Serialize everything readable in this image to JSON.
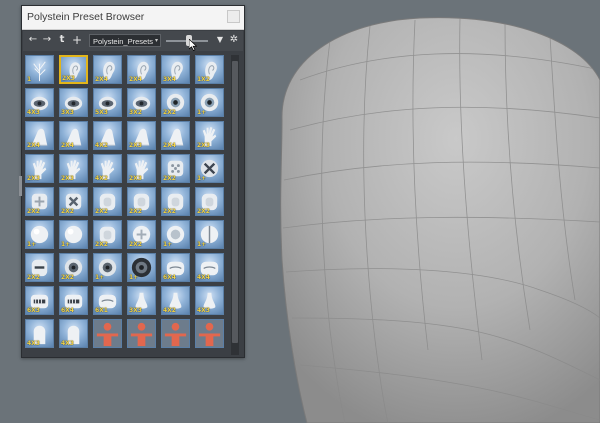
{
  "window": {
    "title": "Polystein Preset Browser"
  },
  "toolbar": {
    "back_glyph": "←",
    "forward_glyph": "→",
    "up_glyph": "t",
    "add_glyph": "+",
    "preset_value": "Polystein_Presets",
    "dropdown_glyph": "▾",
    "filter_glyph": "▼",
    "settings_glyph": "✲",
    "zoom_level": 0.55
  },
  "colors": {
    "tile_blue": "#90b3d8",
    "selected_border": "#e2b51a",
    "size_label": "#f1d448",
    "figure_red": "#e2674e",
    "mesh_gray": "#b4b4b4",
    "viewport_bg": "#6b7379"
  },
  "presets": [
    {
      "icon": "branch-icon",
      "size": "1"
    },
    {
      "icon": "ear-icon",
      "size": "2X3",
      "selected": true
    },
    {
      "icon": "ear-icon",
      "size": "2X4"
    },
    {
      "icon": "ear-icon",
      "size": "2X4"
    },
    {
      "icon": "ear-icon",
      "size": "3X4"
    },
    {
      "icon": "ear-icon",
      "size": "1X2"
    },
    {
      "icon": "eye-icon",
      "size": "4X3"
    },
    {
      "icon": "eye-icon",
      "size": "3X3"
    },
    {
      "icon": "eye-icon",
      "size": "5X3"
    },
    {
      "icon": "eye-icon",
      "size": "3X2"
    },
    {
      "icon": "eyeball-icon",
      "size": "2X2"
    },
    {
      "icon": "eyeball-icon",
      "size": "1+"
    },
    {
      "icon": "foot-icon",
      "size": "2X4"
    },
    {
      "icon": "foot-icon",
      "size": "2X4"
    },
    {
      "icon": "foot-icon",
      "size": "4X2"
    },
    {
      "icon": "foot-icon",
      "size": "2X3"
    },
    {
      "icon": "foot-icon",
      "size": "2X4"
    },
    {
      "icon": "hand-icon",
      "size": "2X3"
    },
    {
      "icon": "hand-icon",
      "size": "2X3"
    },
    {
      "icon": "hand-icon",
      "size": "2X3"
    },
    {
      "icon": "hand-icon",
      "size": "4X2"
    },
    {
      "icon": "hand-icon",
      "size": "2X3"
    },
    {
      "icon": "dots-icon",
      "size": "2X2"
    },
    {
      "icon": "x-knob-icon",
      "size": "1+"
    },
    {
      "icon": "plus-block-icon",
      "size": "2X2"
    },
    {
      "icon": "x-block-icon",
      "size": "2X2"
    },
    {
      "icon": "block-icon",
      "size": "2X2"
    },
    {
      "icon": "block-icon",
      "size": "2X2"
    },
    {
      "icon": "block-icon",
      "size": "2X2"
    },
    {
      "icon": "block-icon",
      "size": "2X2"
    },
    {
      "icon": "sphere-icon",
      "size": "1+"
    },
    {
      "icon": "sphere-icon",
      "size": "1+"
    },
    {
      "icon": "block-icon",
      "size": "2X2"
    },
    {
      "icon": "plus-sphere-icon",
      "size": "2X2"
    },
    {
      "icon": "ring-icon",
      "size": "1+"
    },
    {
      "icon": "split-sphere-icon",
      "size": "1+"
    },
    {
      "icon": "minus-block-icon",
      "size": "2X2"
    },
    {
      "icon": "disc-icon",
      "size": "2X2"
    },
    {
      "icon": "disc-icon",
      "size": "1+"
    },
    {
      "icon": "gear-disc-icon",
      "size": "1+"
    },
    {
      "icon": "mouth-icon",
      "size": "6X4"
    },
    {
      "icon": "mouth-icon",
      "size": "4X4"
    },
    {
      "icon": "teeth-icon",
      "size": "6X3"
    },
    {
      "icon": "teeth-icon",
      "size": "6X4"
    },
    {
      "icon": "mouth-icon",
      "size": "6X1"
    },
    {
      "icon": "nose-icon",
      "size": "3X3"
    },
    {
      "icon": "nose-icon",
      "size": "4X2"
    },
    {
      "icon": "nose-icon",
      "size": "4X3"
    },
    {
      "icon": "torso-icon",
      "size": "4X3"
    },
    {
      "icon": "torso-icon",
      "size": "4X3"
    },
    {
      "icon": "figure-icon",
      "size": ""
    },
    {
      "icon": "figure-icon",
      "size": ""
    },
    {
      "icon": "figure-icon",
      "size": ""
    },
    {
      "icon": "figure-icon",
      "size": ""
    }
  ]
}
